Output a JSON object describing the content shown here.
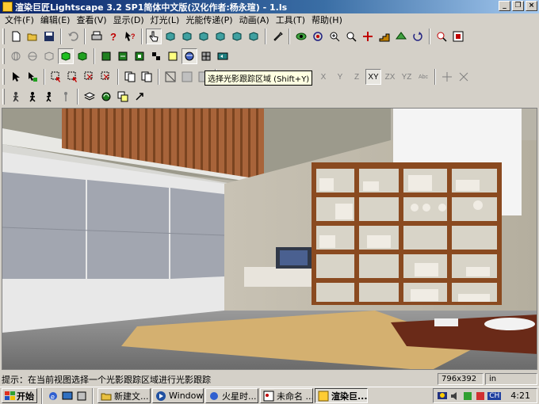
{
  "window": {
    "title": "渲染巨匠Lightscape 3.2 SP1简体中文版(汉化作者:杨永瑄) - 1.ls",
    "minimize": "_",
    "restore": "❐",
    "close": "×"
  },
  "menu": [
    "文件(F)",
    "编辑(E)",
    "查看(V)",
    "显示(D)",
    "灯光(L)",
    "光能传递(P)",
    "动画(A)",
    "工具(T)",
    "帮助(H)"
  ],
  "axis_buttons": [
    "X",
    "Y",
    "Z",
    "XY",
    "ZX",
    "YZ",
    "Abc"
  ],
  "tooltip": "选择光影跟踪区域 (Shift+Y)",
  "status": {
    "text": "提示：在当前视图选择一个光影跟踪区域进行光影跟踪",
    "dimensions": "796x392",
    "unit": "in"
  },
  "taskbar": {
    "start": "开始",
    "tasks": [
      "新建文...",
      "Window...",
      "火星时...",
      "未命名 ...",
      "渲染巨..."
    ],
    "clock": "4:21",
    "tray_lang": "CH"
  },
  "colors": {
    "title_start": "#0a246a",
    "title_end": "#a6caf0",
    "face": "#d4d0c8"
  }
}
